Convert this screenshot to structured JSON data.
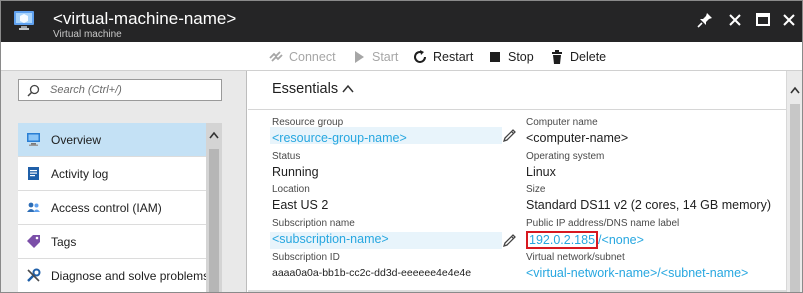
{
  "window": {
    "title": "<virtual-machine-name>",
    "subtitle": "Virtual machine"
  },
  "toolbar": {
    "connect_label": "Connect",
    "start_label": "Start",
    "restart_label": "Restart",
    "stop_label": "Stop",
    "delete_label": "Delete"
  },
  "search": {
    "placeholder": "Search (Ctrl+/)"
  },
  "sidebar": {
    "items": [
      {
        "label": "Overview",
        "icon": "monitor-icon",
        "active": true
      },
      {
        "label": "Activity log",
        "icon": "log-icon",
        "active": false
      },
      {
        "label": "Access control (IAM)",
        "icon": "users-icon",
        "active": false
      },
      {
        "label": "Tags",
        "icon": "tag-icon",
        "active": false
      },
      {
        "label": "Diagnose and solve problems",
        "icon": "wrench-icon",
        "active": false
      }
    ]
  },
  "essentials": {
    "title": "Essentials",
    "left": [
      {
        "label": "Resource group",
        "value": "<resource-group-name>"
      },
      {
        "label": "Status",
        "value": "Running"
      },
      {
        "label": "Location",
        "value": "East US 2"
      },
      {
        "label": "Subscription name",
        "value": "<subscription-name>"
      },
      {
        "label": "Subscription ID",
        "value": "aaaa0a0a-bb1b-cc2c-dd3d-eeeeee4e4e4e"
      }
    ],
    "right": [
      {
        "label": "Computer name",
        "value": "<computer-name>"
      },
      {
        "label": "Operating system",
        "value": "Linux"
      },
      {
        "label": "Size",
        "value": "Standard DS11 v2 (2 cores, 14 GB memory)"
      },
      {
        "label": "Public IP address/DNS name label",
        "ip": "192.0.2.185",
        "separator": "/",
        "dns": "<none>"
      },
      {
        "label": "Virtual network/subnet",
        "value": "<virtual-network-name>/<subnet-name>"
      }
    ]
  },
  "colors": {
    "titlebar": "#252526",
    "link": "#27a7e0",
    "nav_active": "#c4e1f5",
    "highlight": "#d71920"
  }
}
